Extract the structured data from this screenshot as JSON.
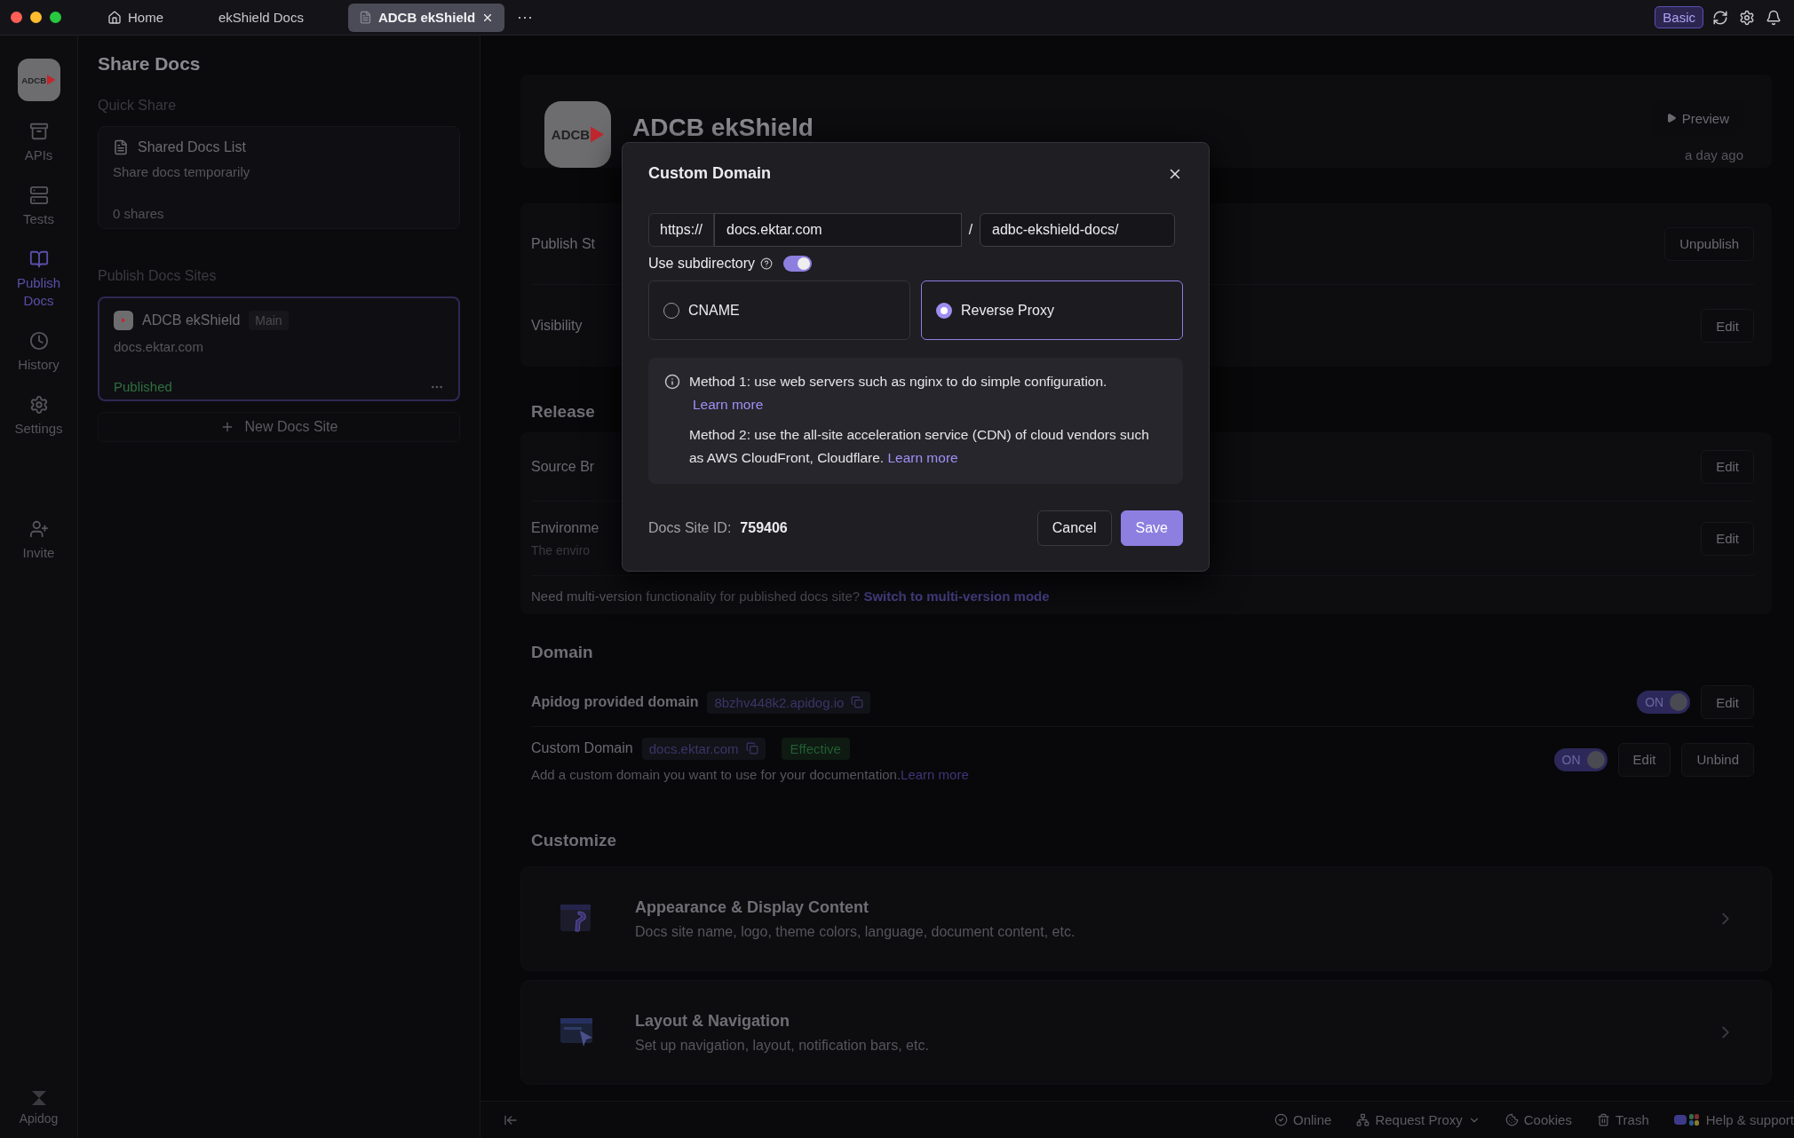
{
  "tabs": [
    {
      "label": "Home",
      "kind": "home",
      "selected": false,
      "closable": false
    },
    {
      "label": "ekShield Docs",
      "kind": "plain",
      "selected": false,
      "closable": false
    },
    {
      "label": "ADCB ekShield",
      "kind": "doc",
      "selected": true,
      "closable": true
    }
  ],
  "more_tabs": "···",
  "plan_badge": "Basic",
  "nav": {
    "logo_text": "ADCB",
    "items": [
      {
        "label": "APIs",
        "selected": false
      },
      {
        "label": "Tests",
        "selected": false
      },
      {
        "label": "Publish Docs",
        "selected": true
      },
      {
        "label": "History",
        "selected": false
      },
      {
        "label": "Settings",
        "selected": false
      },
      {
        "label": "Invite",
        "selected": false
      }
    ],
    "footer": "Apidog"
  },
  "share_panel": {
    "title": "Share Docs",
    "quick_share_heading": "Quick Share",
    "shared_list": {
      "title": "Shared Docs List",
      "subtitle": "Share docs temporarily",
      "count": "0 shares"
    },
    "sites_heading": "Publish Docs Sites",
    "sites": [
      {
        "name": "ADCB ekShield",
        "branch": "Main",
        "domain": "docs.ektar.com",
        "status": "Published",
        "selected": true
      }
    ],
    "new_site": "New Docs Site"
  },
  "site_header": {
    "logo_text": "ADCB",
    "name": "ADCB ekShield",
    "preview": "Preview",
    "updated": "a day ago"
  },
  "settings_rows": [
    {
      "label": "Publish St",
      "action": "Unpublish"
    },
    {
      "label": "Visibility",
      "action": "Edit"
    }
  ],
  "release": {
    "heading": "Release",
    "rows": [
      {
        "label": "Source Br",
        "action": "Edit"
      },
      {
        "label": "Environme",
        "description": "The enviro",
        "action": "Edit"
      }
    ],
    "note": "Need multi-version functionality for published docs site?",
    "note_link": "Switch to multi-version mode"
  },
  "domain": {
    "heading": "Domain",
    "rows": [
      {
        "label": "Apidog provided domain",
        "value": "8bzhv448k2.apidog.io",
        "toggle_label": "ON",
        "on": true,
        "actions": [
          "Edit"
        ]
      },
      {
        "label": "Custom Domain",
        "value": "docs.ektar.com",
        "badge": "Effective",
        "description": "Add a custom domain you want to use for your documentation.",
        "link": "Learn more",
        "toggle_label": "ON",
        "on": true,
        "actions": [
          "Edit",
          "Unbind"
        ]
      }
    ]
  },
  "customize": {
    "heading": "Customize",
    "cards": [
      {
        "title": "Appearance & Display Content",
        "description": "Docs site name, logo, theme colors, language, document content, etc."
      },
      {
        "title": "Layout & Navigation",
        "description": "Set up navigation, layout, notification bars, etc."
      }
    ]
  },
  "dialog": {
    "title": "Custom Domain",
    "protocol": "https://",
    "domain_value": "docs.ektar.com",
    "separator": "/",
    "path_value": "adbc-ekshield-docs/",
    "subdirectory_label": "Use subdirectory",
    "subdirectory_on": true,
    "methods": [
      {
        "label": "CNAME",
        "selected": false
      },
      {
        "label": "Reverse Proxy",
        "selected": true
      }
    ],
    "info": [
      {
        "text": "Method 1: use web servers such as nginx to do simple configuration.",
        "link": "Learn more"
      },
      {
        "text": "Method 2: use the all-site acceleration service (CDN) of cloud vendors such as AWS CloudFront, Cloudflare.",
        "link": "Learn more"
      }
    ],
    "site_id_label": "Docs Site ID:",
    "site_id": "759406",
    "cancel": "Cancel",
    "save": "Save"
  },
  "status_bar": [
    {
      "label": "Online",
      "dropdown": false
    },
    {
      "label": "Request Proxy",
      "dropdown": true
    },
    {
      "label": "Cookies",
      "dropdown": false
    },
    {
      "label": "Trash",
      "dropdown": false
    },
    {
      "label": "Help & support",
      "dropdown": false
    }
  ]
}
